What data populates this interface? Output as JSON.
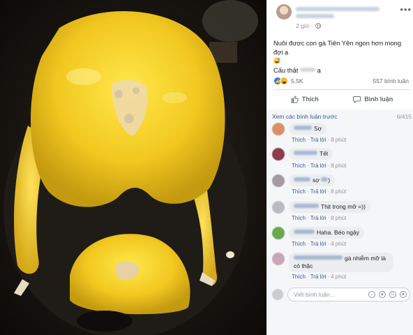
{
  "post": {
    "time": "2 giờ",
    "caption_line1": "Nuôi được con gà Tiên Yên ngon hơn mong đợi ạ",
    "caption_line2_prefix": "Cấu thật",
    "caption_line2_suffix": "ạ",
    "more_label": "•••"
  },
  "stats": {
    "reactions_count": "5,5K",
    "comments_count": "557 bình luận"
  },
  "actions": {
    "like_label": "Thích",
    "comment_label": "Bình luận"
  },
  "comments_section": {
    "view_previous": "Xem các bình luận trước",
    "pagination": "6/415",
    "like_label": "Thích",
    "reply_label": "Trả lời",
    "write_placeholder": "Viết bình luận...",
    "items": [
      {
        "text": "Sợ",
        "time": "8 phút",
        "avatar_color": "#d98f6b"
      },
      {
        "text": "Tết",
        "time": "8 phút",
        "avatar_color": "#8a3e4d"
      },
      {
        "text": "sợ",
        "suffix": ")",
        "time": "8 phút",
        "avatar_color": "#a59aa3"
      },
      {
        "text": "Thịt trong mỡ =))",
        "time": "8 phút",
        "avatar_color": "#b8bcc2"
      },
      {
        "text": "Haha. Béo ngậy",
        "time": "4 phút",
        "avatar_color": "#6aa84f"
      },
      {
        "text": "gà nhiễm mỡ là có thặc",
        "time": "4 phút",
        "avatar_color": "#c9a5b8"
      }
    ]
  },
  "colors": {
    "link": "#385898",
    "muted": "#90949c",
    "like_blue": "#2078f4",
    "bubble": "#ebedf0",
    "chicken_yellow": "#f2c820"
  }
}
